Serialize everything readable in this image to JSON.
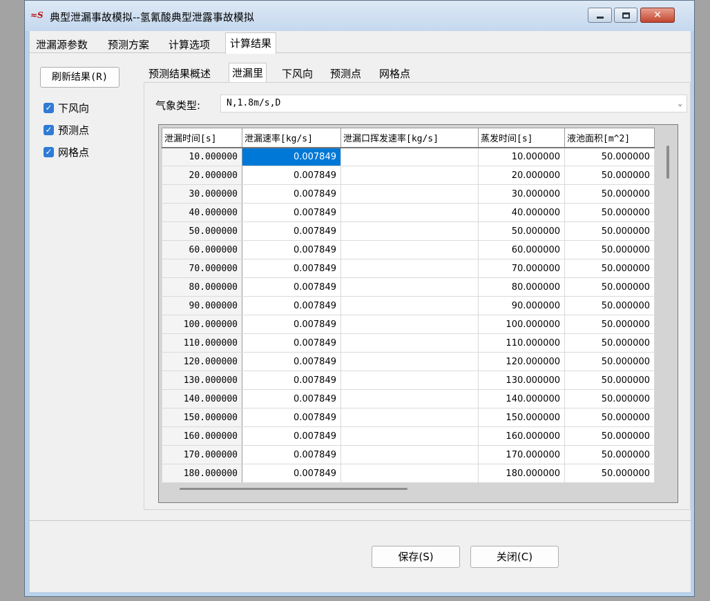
{
  "window": {
    "title": "典型泄漏事故模拟--氢氰酸典型泄露事故模拟",
    "icon": "app-logo-icon"
  },
  "main_tabs": [
    "泄漏源参数",
    "预测方案",
    "计算选项",
    "计算结果"
  ],
  "main_tabs_active": "计算结果",
  "sidebar": {
    "refresh_button": "刷新结果(R)",
    "checkboxes": [
      {
        "label": "下风向",
        "checked": true
      },
      {
        "label": "预测点",
        "checked": true
      },
      {
        "label": "网格点",
        "checked": true
      }
    ]
  },
  "sub_tabs": [
    "预测结果概述",
    "泄漏里",
    "下风向",
    "预测点",
    "网格点"
  ],
  "sub_tabs_active": "泄漏里",
  "weather": {
    "label": "气象类型:",
    "value": "N,1.8m/s,D"
  },
  "grid": {
    "columns": [
      "泄漏时间[s]",
      "泄漏速率[kg/s]",
      "泄漏口挥发速率[kg/s]",
      "蒸发时间[s]",
      "液池面积[m^2]"
    ],
    "rows": [
      [
        "10.000000",
        "0.007849",
        "",
        "10.000000",
        "50.000000"
      ],
      [
        "20.000000",
        "0.007849",
        "",
        "20.000000",
        "50.000000"
      ],
      [
        "30.000000",
        "0.007849",
        "",
        "30.000000",
        "50.000000"
      ],
      [
        "40.000000",
        "0.007849",
        "",
        "40.000000",
        "50.000000"
      ],
      [
        "50.000000",
        "0.007849",
        "",
        "50.000000",
        "50.000000"
      ],
      [
        "60.000000",
        "0.007849",
        "",
        "60.000000",
        "50.000000"
      ],
      [
        "70.000000",
        "0.007849",
        "",
        "70.000000",
        "50.000000"
      ],
      [
        "80.000000",
        "0.007849",
        "",
        "80.000000",
        "50.000000"
      ],
      [
        "90.000000",
        "0.007849",
        "",
        "90.000000",
        "50.000000"
      ],
      [
        "100.000000",
        "0.007849",
        "",
        "100.000000",
        "50.000000"
      ],
      [
        "110.000000",
        "0.007849",
        "",
        "110.000000",
        "50.000000"
      ],
      [
        "120.000000",
        "0.007849",
        "",
        "120.000000",
        "50.000000"
      ],
      [
        "130.000000",
        "0.007849",
        "",
        "130.000000",
        "50.000000"
      ],
      [
        "140.000000",
        "0.007849",
        "",
        "140.000000",
        "50.000000"
      ],
      [
        "150.000000",
        "0.007849",
        "",
        "150.000000",
        "50.000000"
      ],
      [
        "160.000000",
        "0.007849",
        "",
        "160.000000",
        "50.000000"
      ],
      [
        "170.000000",
        "0.007849",
        "",
        "170.000000",
        "50.000000"
      ],
      [
        "180.000000",
        "0.007849",
        "",
        "180.000000",
        "50.000000"
      ]
    ]
  },
  "footer": {
    "save_button": "保存(S)",
    "close_button": "关闭(C)"
  },
  "colors": {
    "selection": "#0078d7",
    "checkbox": "#2f7bd6",
    "close_button": "#c2452e"
  }
}
